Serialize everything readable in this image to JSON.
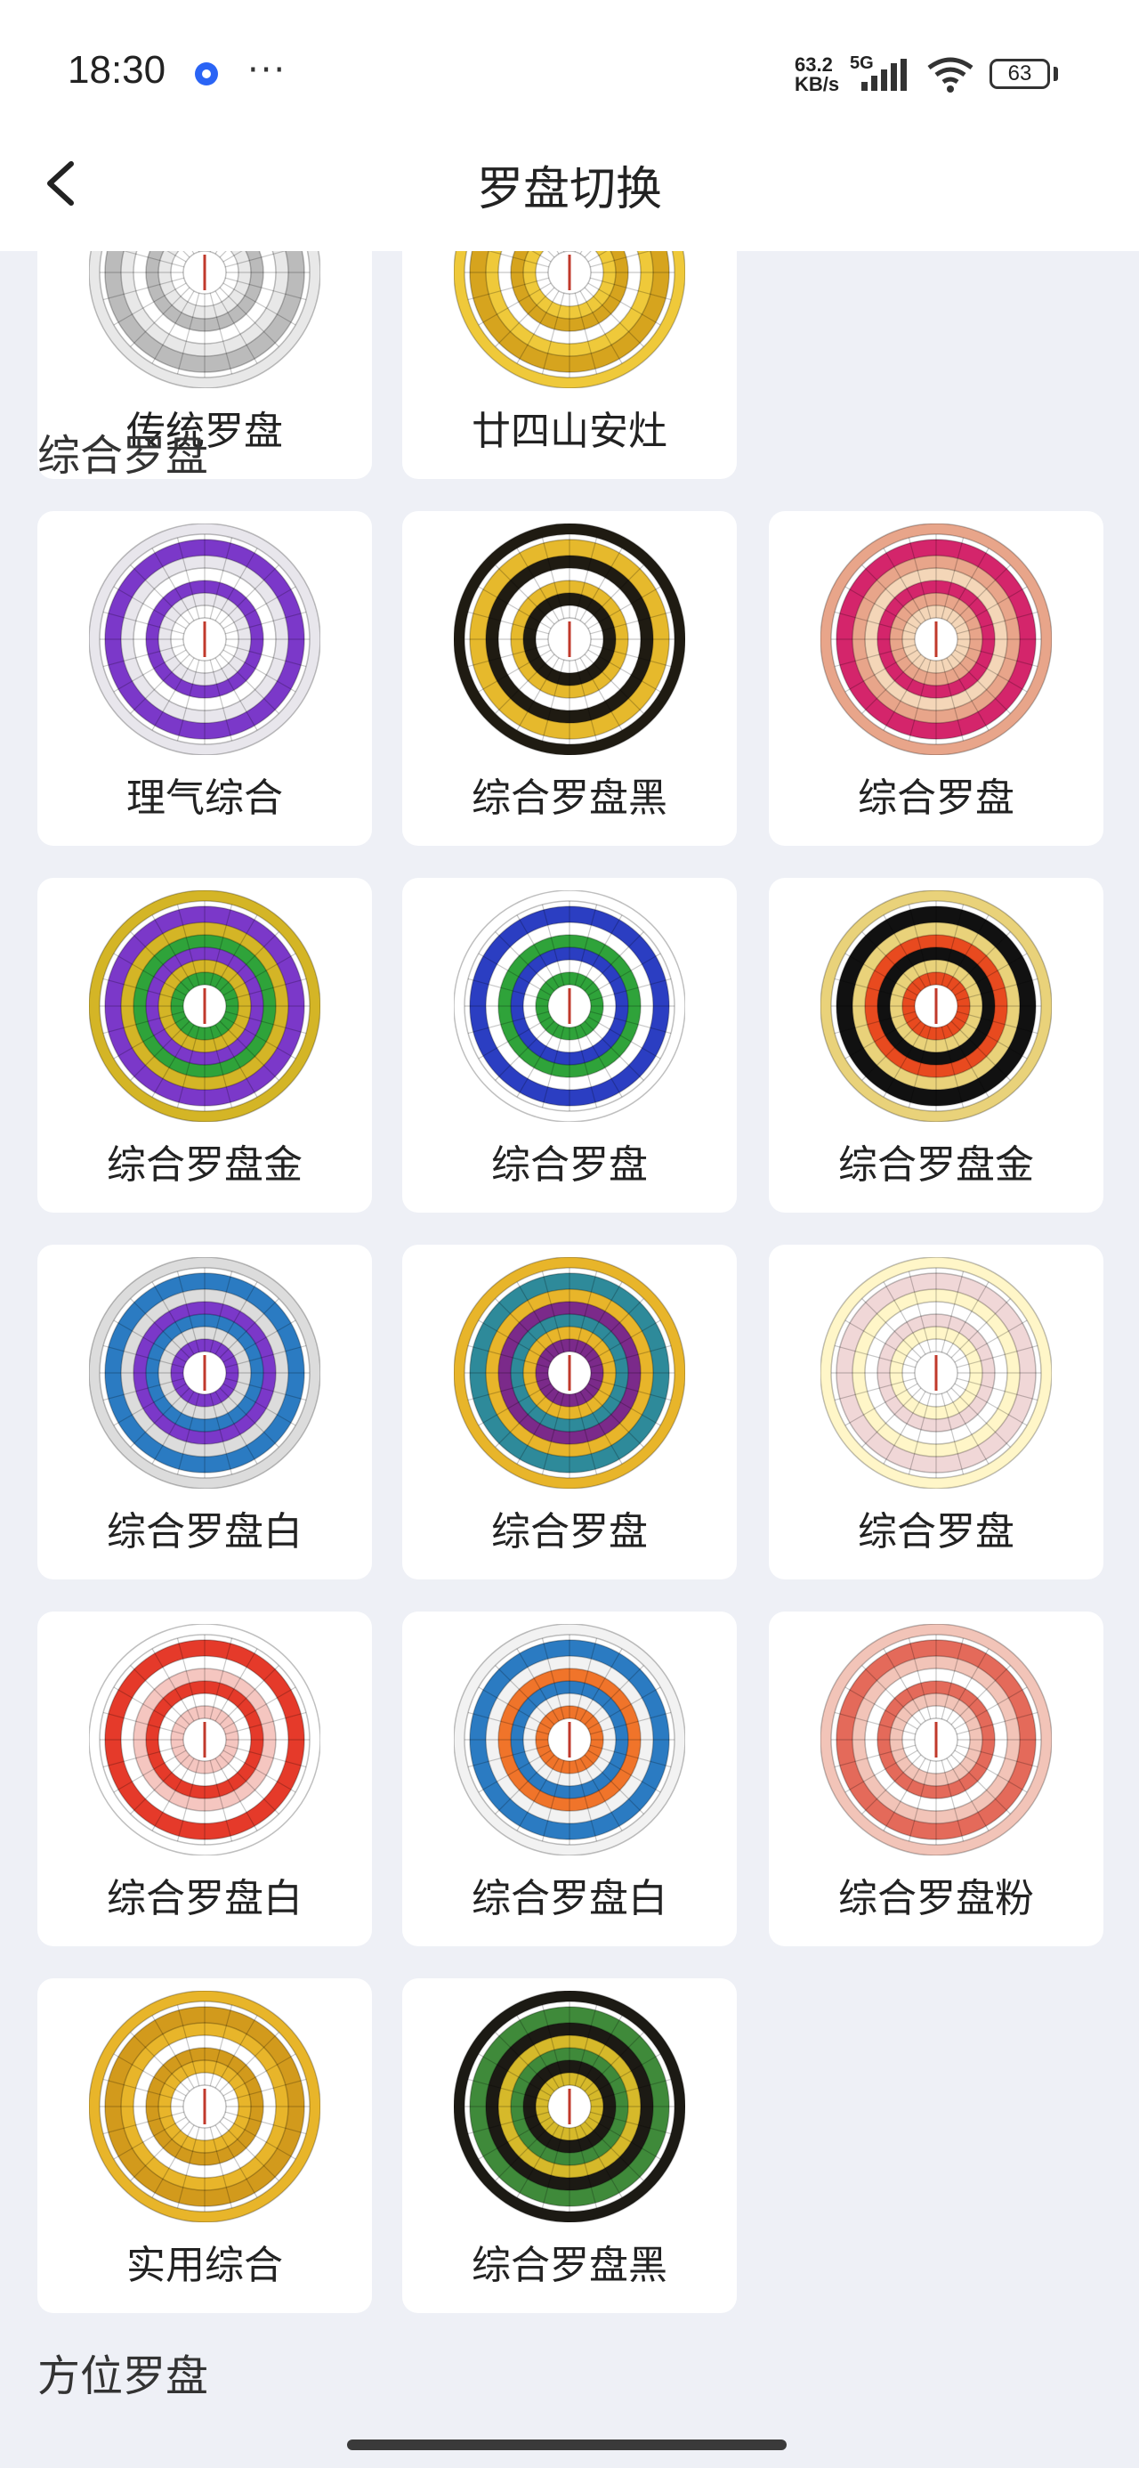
{
  "status_bar": {
    "time": "18:30",
    "net_speed_value": "63.2",
    "net_speed_unit": "KB/s",
    "network": "5G",
    "battery": "63"
  },
  "header": {
    "title": "罗盘切换"
  },
  "sections": [
    {
      "title": "",
      "items": [
        "传统罗盘",
        "廿四山安灶"
      ]
    },
    {
      "title": "综合罗盘",
      "items": [
        "理气综合",
        "综合罗盘黑",
        "综合罗盘",
        "综合罗盘金",
        "综合罗盘",
        "综合罗盘金",
        "综合罗盘白",
        "综合罗盘",
        "综合罗盘",
        "综合罗盘白",
        "综合罗盘白",
        "综合罗盘粉",
        "实用综合",
        "综合罗盘黑"
      ]
    },
    {
      "title": "方位罗盘",
      "items": []
    }
  ],
  "colors": {
    "page_bg": "#eef0f6",
    "card_bg": "#ffffff",
    "accent_blue": "#2a64f5"
  }
}
